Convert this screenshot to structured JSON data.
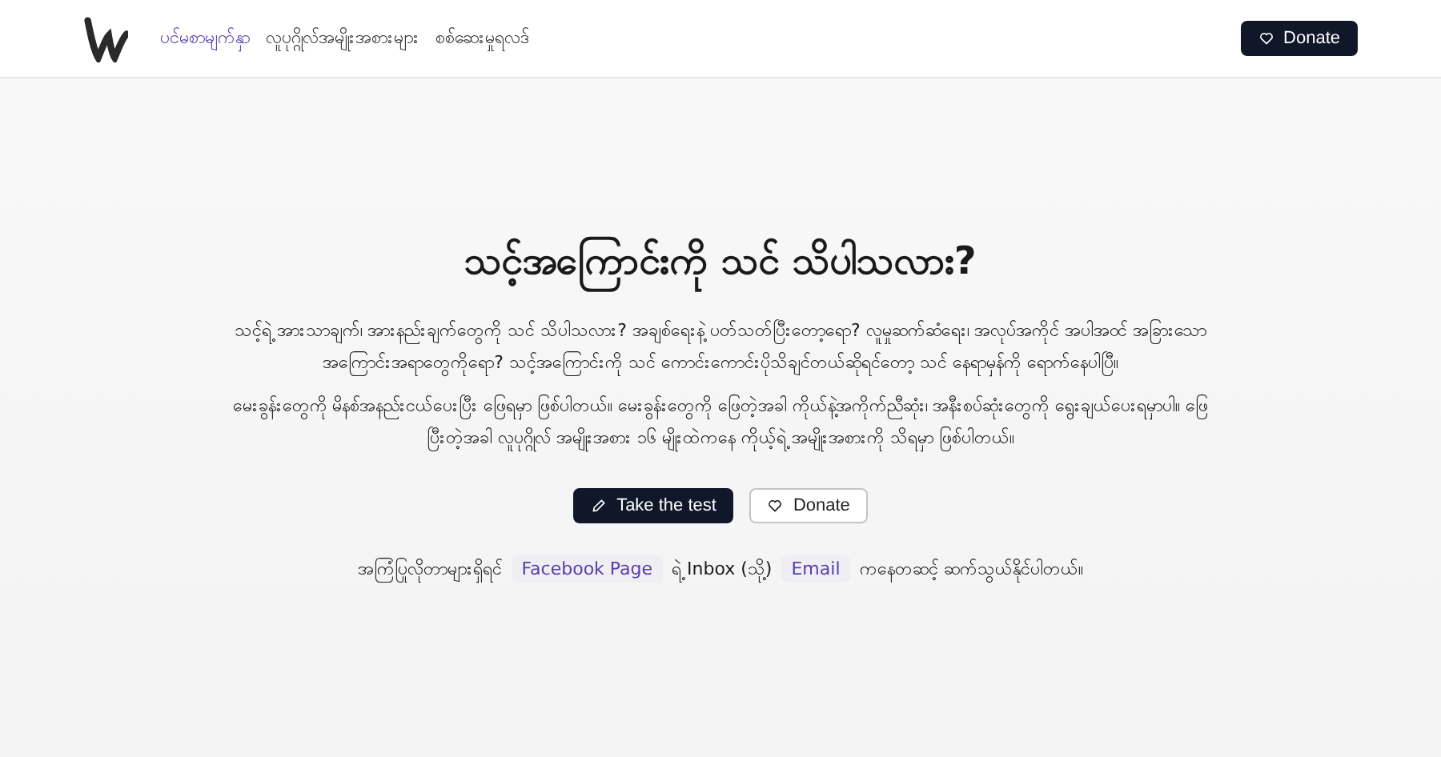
{
  "nav": {
    "items": [
      {
        "label": "ပင်မစာမျက်နှာ",
        "selected": true
      },
      {
        "label": "လူပုဂ္ဂိုလ်အမျိုးအစားများ",
        "selected": false
      },
      {
        "label": "စစ်ဆေးမှုရလဒ်",
        "selected": false
      }
    ],
    "donate": "Donate"
  },
  "hero": {
    "title": "သင့်အကြောင်းကို သင် သိပါသလား?",
    "paragraphs": [
      "သင့်ရဲ့ အားသာချက်၊ အားနည်းချက်တွေကို သင် သိပါသလား? အချစ်ရေးနဲ့ ပတ်သတ်ပြီးတော့ရော? လူမှုဆက်ဆံရေး၊ အလုပ်အကိုင် အပါအဝင် အခြားသော အကြောင်းအရာတွေကိုရော? သင့်အကြောင်းကို သင် ကောင်းကောင်းပိုသိချင်တယ်ဆိုရင်တော့ သင် နေရာမှန်ကို ရောက်နေပါပြီ။",
      "မေးခွန်းတွေကို မိနစ်အနည်းငယ်ပေးပြီး ဖြေရမှာ ဖြစ်ပါတယ်။ မေးခွန်းတွေကို ဖြေတဲ့အခါ ကိုယ်နဲ့အကိုက်ညီဆုံး၊ အနီးစပ်ဆုံးတွေကို ရွေးချယ်ပေးရမှာပါ။ ဖြေပြီးတဲ့အခါ လူပုဂ္ဂိုလ် အမျိုးအစား ၁၆ မျိုးထဲကနေ ကိုယ့်ရဲ့ အမျိုးအစားကို သိရမှာ ဖြစ်ပါတယ်။"
    ],
    "buttons": [
      {
        "label": "Take the test",
        "kind": "primary"
      },
      {
        "label": "Donate",
        "kind": "outline"
      }
    ]
  },
  "contact": [
    {
      "text": "အကြံပြုလိုတာများရှိရင်",
      "kind": "text"
    },
    {
      "text": "Facebook Page",
      "kind": "link"
    },
    {
      "text": "ရဲ့ Inbox (သို့)",
      "kind": "text"
    },
    {
      "text": "Email",
      "kind": "link"
    },
    {
      "text": "ကနေတဆင့် ဆက်သွယ်နိုင်ပါတယ်။",
      "kind": "text"
    }
  ]
}
